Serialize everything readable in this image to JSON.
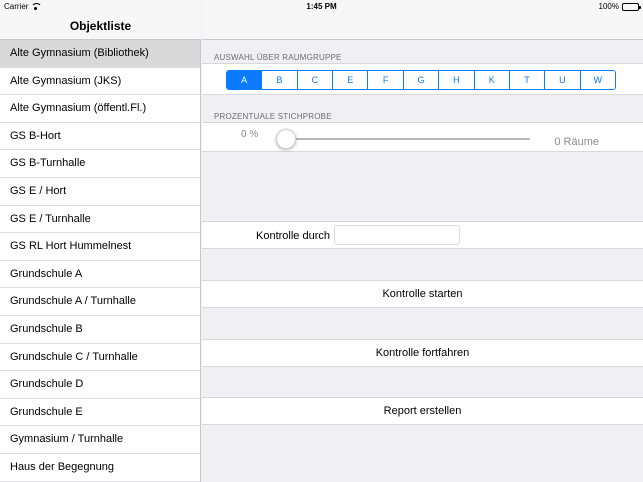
{
  "statusbar": {
    "carrier": "Carrier",
    "time": "1:45 PM",
    "battery": "100%",
    "icons": [
      "wifi-icon",
      "battery-icon"
    ]
  },
  "sidebar": {
    "title": "Objektliste",
    "selected_index": 0,
    "items": [
      "Alte Gymnasium (Bibliothek)",
      "Alte Gymnasium (JKS)",
      "Alte Gymnasium (öffentl.Fl.)",
      "GS B-Hort",
      "GS B-Turnhalle",
      "GS E / Hort",
      "GS E / Turnhalle",
      "GS RL Hort Hummelnest",
      "Grundschule A",
      "Grundschule A / Turnhalle",
      "Grundschule B",
      "Grundschule C / Turnhalle",
      "Grundschule D",
      "Grundschule E",
      "Gymnasium / Turnhalle",
      "Haus der Begegnung"
    ]
  },
  "main": {
    "group_section_label": "AUSWAHL ÜBER RAUMGRUPPE",
    "groups": [
      "A",
      "B",
      "C",
      "E",
      "F",
      "G",
      "H",
      "K",
      "T",
      "U",
      "W"
    ],
    "selected_group": "A",
    "sample_section_label": "PROZENTUALE STICHPROBE",
    "percent_text": "0 %",
    "slider_value": 0,
    "rooms_text": "0 Räume",
    "inspector_label": "Kontrolle durch",
    "inspector_value": "",
    "start_button": "Kontrolle starten",
    "continue_button": "Kontrolle fortfahren",
    "report_button": "Report erstellen"
  },
  "colors": {
    "accent": "#0a7aff",
    "background": "#efeff4",
    "selected_row": "#d9d9d9"
  }
}
